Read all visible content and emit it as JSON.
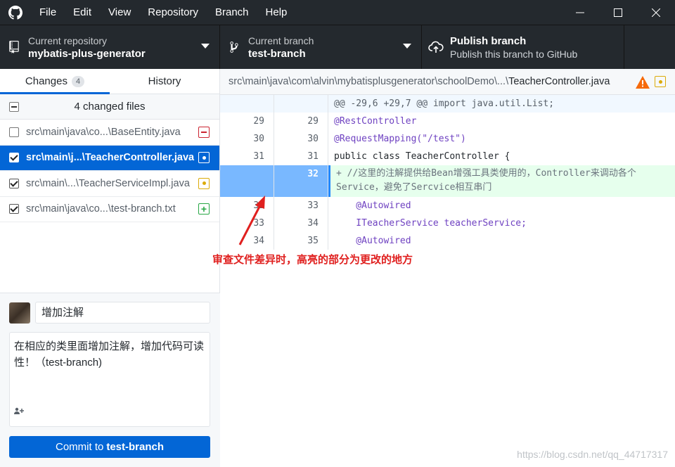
{
  "menu": [
    "File",
    "Edit",
    "View",
    "Repository",
    "Branch",
    "Help"
  ],
  "toolbar": {
    "repo_label": "Current repository",
    "repo_value": "mybatis-plus-generator",
    "branch_label": "Current branch",
    "branch_value": "test-branch",
    "publish_label": "Publish branch",
    "publish_sub": "Publish this branch to GitHub"
  },
  "sidebar": {
    "tab_changes": "Changes",
    "tab_changes_count": "4",
    "tab_history": "History",
    "changed_title": "4 changed files",
    "files": [
      {
        "name": "src\\main\\java\\co...\\BaseEntity.java",
        "status": "deleted",
        "checked": false,
        "selected": false
      },
      {
        "name": "src\\main\\j...\\TeacherController.java",
        "status": "modified",
        "checked": true,
        "selected": true
      },
      {
        "name": "src\\main\\...\\TeacherServiceImpl.java",
        "status": "modified",
        "checked": true,
        "selected": false
      },
      {
        "name": "src\\main\\java\\co...\\test-branch.txt",
        "status": "added",
        "checked": true,
        "selected": false
      }
    ]
  },
  "commit": {
    "summary": "增加注解",
    "description": "在相应的类里面增加注解，增加代码可读性！（test-branch)",
    "button_prefix": "Commit to",
    "button_branch": "test-branch"
  },
  "diff": {
    "path_prefix": "src\\main\\java\\com\\alvin\\mybatisplusgenerator\\schoolDemo\\...\\",
    "path_file": "TeacherController.java",
    "hunk": "@@ -29,6 +29,7 @@ import java.util.List;",
    "lines": [
      {
        "old": "29",
        "new": "29",
        "text": "@RestController"
      },
      {
        "old": "30",
        "new": "30",
        "text": "@RequestMapping(\"/test\")"
      },
      {
        "old": "31",
        "new": "31",
        "text": "public class TeacherController {"
      },
      {
        "old": "",
        "new": "32",
        "text": "+  //这里的注解提供给Bean增强工具类使用的，Controller来调动各个Service，避免了Sercvice相互串门"
      },
      {
        "old": "32",
        "new": "33",
        "text": "    @Autowired"
      },
      {
        "old": "33",
        "new": "34",
        "text": "    ITeacherService teacherService;"
      },
      {
        "old": "34",
        "new": "35",
        "text": "    @Autowired"
      }
    ]
  },
  "annotation": "审查文件差异时，高亮的部分为更改的地方",
  "watermark": "https://blog.csdn.net/qq_44717317",
  "colors": {
    "accent": "#0366d6",
    "toolbar_bg": "#24292e",
    "annotation": "#e0201f"
  }
}
